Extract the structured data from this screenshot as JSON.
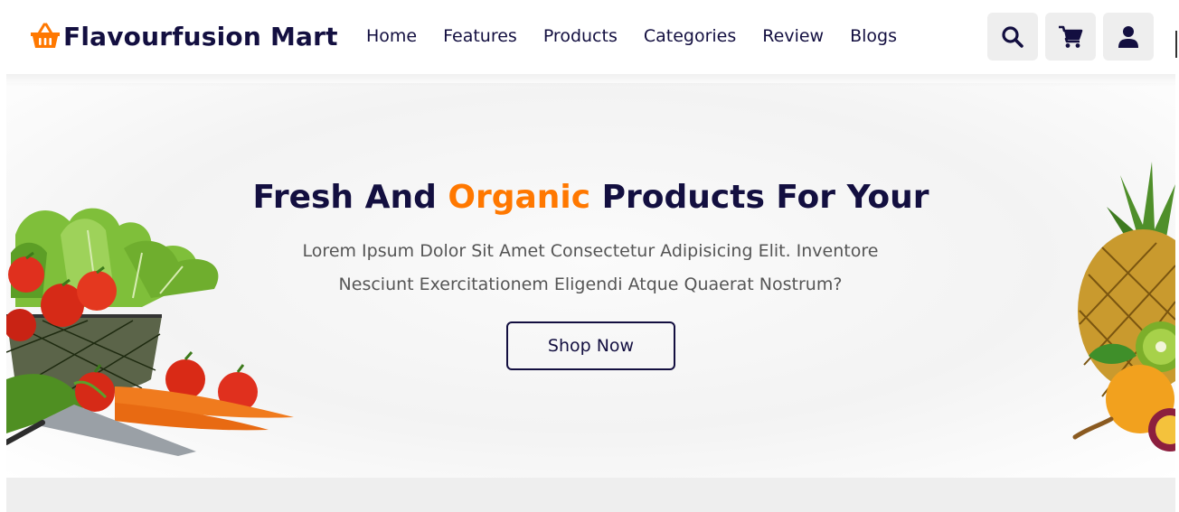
{
  "brand": {
    "name": "Flavourfusion Mart",
    "logo_icon": "shopping-basket-icon",
    "accent_color": "#ff7800",
    "primary_color": "#130f40"
  },
  "nav": {
    "items": [
      {
        "label": "Home"
      },
      {
        "label": "Features"
      },
      {
        "label": "Products"
      },
      {
        "label": "Categories"
      },
      {
        "label": "Review"
      },
      {
        "label": "Blogs"
      }
    ]
  },
  "header_icons": [
    {
      "name": "search-icon"
    },
    {
      "name": "cart-icon"
    },
    {
      "name": "user-icon"
    }
  ],
  "hero": {
    "title_before": "Fresh And ",
    "title_accent": "Organic",
    "title_after": " Products For Your",
    "description": "Lorem Ipsum Dolor Sit Amet Consectetur Adipisicing Elit. Inventore Nesciunt Exercitationem Eligendi Atque Quaerat Nostrum?",
    "cta_label": "Shop Now"
  }
}
